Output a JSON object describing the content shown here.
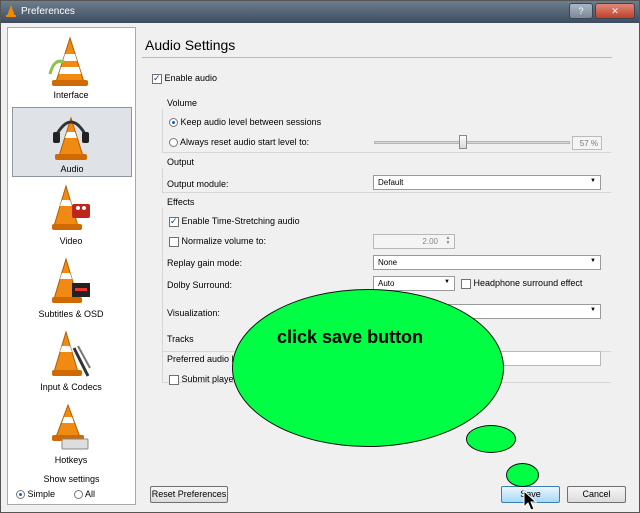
{
  "window": {
    "title": "Preferences",
    "help_label": "?",
    "close_label": "✕"
  },
  "sidebar": {
    "items": [
      {
        "label": "Interface",
        "icon": "vlc-cone-interface-icon"
      },
      {
        "label": "Audio",
        "icon": "vlc-cone-headphones-icon"
      },
      {
        "label": "Video",
        "icon": "vlc-cone-video-icon"
      },
      {
        "label": "Subtitles & OSD",
        "icon": "vlc-cone-subtitles-icon"
      },
      {
        "label": "Input & Codecs",
        "icon": "vlc-cone-cables-icon"
      },
      {
        "label": "Hotkeys",
        "icon": "vlc-cone-keyboard-icon"
      }
    ],
    "selected": "Audio",
    "show_settings": {
      "label": "Show settings",
      "simple": "Simple",
      "all": "All",
      "selected": "Simple"
    }
  },
  "main": {
    "heading": "Audio Settings",
    "enable_audio": {
      "label": "Enable audio",
      "checked": true
    },
    "volume": {
      "title": "Volume",
      "keep_level": "Keep audio level between sessions",
      "reset_level": "Always reset audio start level to:",
      "percent": "57 %",
      "slider_value": 57
    },
    "output": {
      "title": "Output",
      "module_label": "Output module:",
      "module_value": "Default"
    },
    "effects": {
      "title": "Effects",
      "time_stretch": {
        "label": "Enable Time-Stretching audio",
        "checked": true
      },
      "normalize": {
        "label": "Normalize volume to:",
        "checked": false,
        "value": "2.00"
      },
      "replay_gain_label": "Replay gain mode:",
      "replay_gain_value": "None",
      "dolby_label": "Dolby Surround:",
      "dolby_value": "Auto",
      "headphone_label": "Headphone surround effect",
      "visualization_label": "Visualization:"
    },
    "tracks": {
      "title": "Tracks",
      "preferred_label": "Preferred audio l",
      "submit_label": "Submit player"
    }
  },
  "footer": {
    "reset": "Reset Preferences",
    "save": "Save",
    "cancel": "Cancel"
  },
  "annotation": {
    "text": "click save button",
    "color": "#00ff44"
  }
}
